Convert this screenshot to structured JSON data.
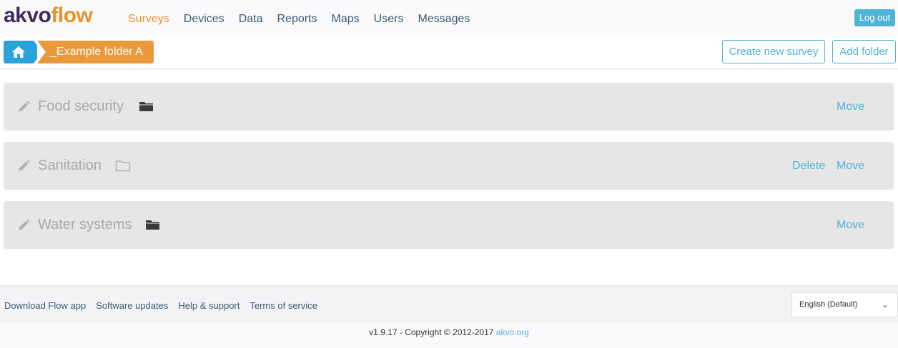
{
  "logo": {
    "part1": "akvo",
    "part2": "flow"
  },
  "nav": {
    "items": [
      "Surveys",
      "Devices",
      "Data",
      "Reports",
      "Maps",
      "Users",
      "Messages"
    ],
    "active": "Surveys"
  },
  "logout_label": "Log out",
  "breadcrumb": {
    "home_icon": "home-icon",
    "folder": "_Example folder A"
  },
  "actions": {
    "create_survey": "Create new survey",
    "add_folder": "Add folder"
  },
  "items": [
    {
      "name": "Food security",
      "folder_icon": "folder-filled-icon",
      "actions": [
        "Move"
      ]
    },
    {
      "name": "Sanitation",
      "folder_icon": "folder-outline-icon",
      "actions": [
        "Delete",
        "Move"
      ]
    },
    {
      "name": "Water systems",
      "folder_icon": "folder-filled-icon",
      "actions": [
        "Move"
      ]
    }
  ],
  "footer": {
    "links": [
      "Download Flow app",
      "Software updates",
      "Help & support",
      "Terms of service"
    ],
    "language": "English (Default)"
  },
  "copyright": {
    "text": "v1.9.17 - Copyright © 2012-2017 ",
    "link": "akvo.org"
  },
  "colors": {
    "brand_purple": "#3e2d5c",
    "brand_orange": "#e8912a",
    "accent_blue": "#4fb3d6",
    "home_blue": "#2aa3db"
  }
}
